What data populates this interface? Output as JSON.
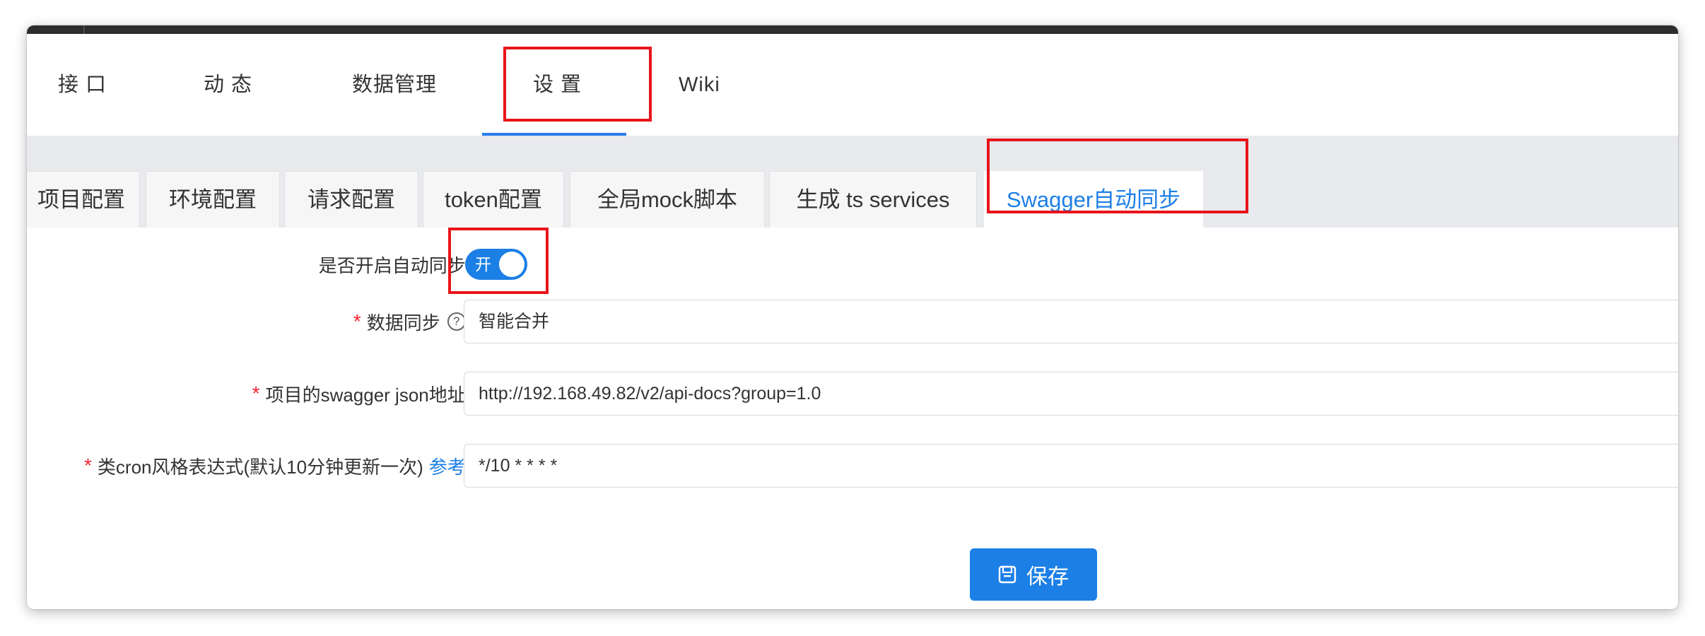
{
  "nav": {
    "items": [
      "接 口",
      "动 态",
      "数据管理",
      "设 置",
      "Wiki"
    ],
    "active_index": 3
  },
  "tabs": {
    "items": [
      "项目配置",
      "环境配置",
      "请求配置",
      "token配置",
      "全局mock脚本",
      "生成 ts services",
      "Swagger自动同步"
    ],
    "active_index": 6
  },
  "form": {
    "auto_sync": {
      "label": "是否开启自动同步",
      "colon": ":",
      "toggle_text": "开",
      "enabled": true
    },
    "data_sync": {
      "required_mark": "*",
      "label": "数据同步",
      "help_icon": "?",
      "colon": ":",
      "value": "智能合并"
    },
    "swagger_url": {
      "required_mark": "*",
      "label": "项目的swagger json地址",
      "colon": ":",
      "value": "http://192.168.49.82/v2/api-docs?group=1.0"
    },
    "cron": {
      "required_mark": "*",
      "label": "类cron风格表达式(默认10分钟更新一次)",
      "link": "参考",
      "colon": ":",
      "value": "*/10 * * * *"
    },
    "save_label": "保存"
  },
  "colors": {
    "accent": "#1c7fe6",
    "highlight_box": "#e8141b",
    "required": "#f5222d"
  },
  "icons": {
    "save": "floppy-disk-icon",
    "help": "question-circle-icon"
  }
}
